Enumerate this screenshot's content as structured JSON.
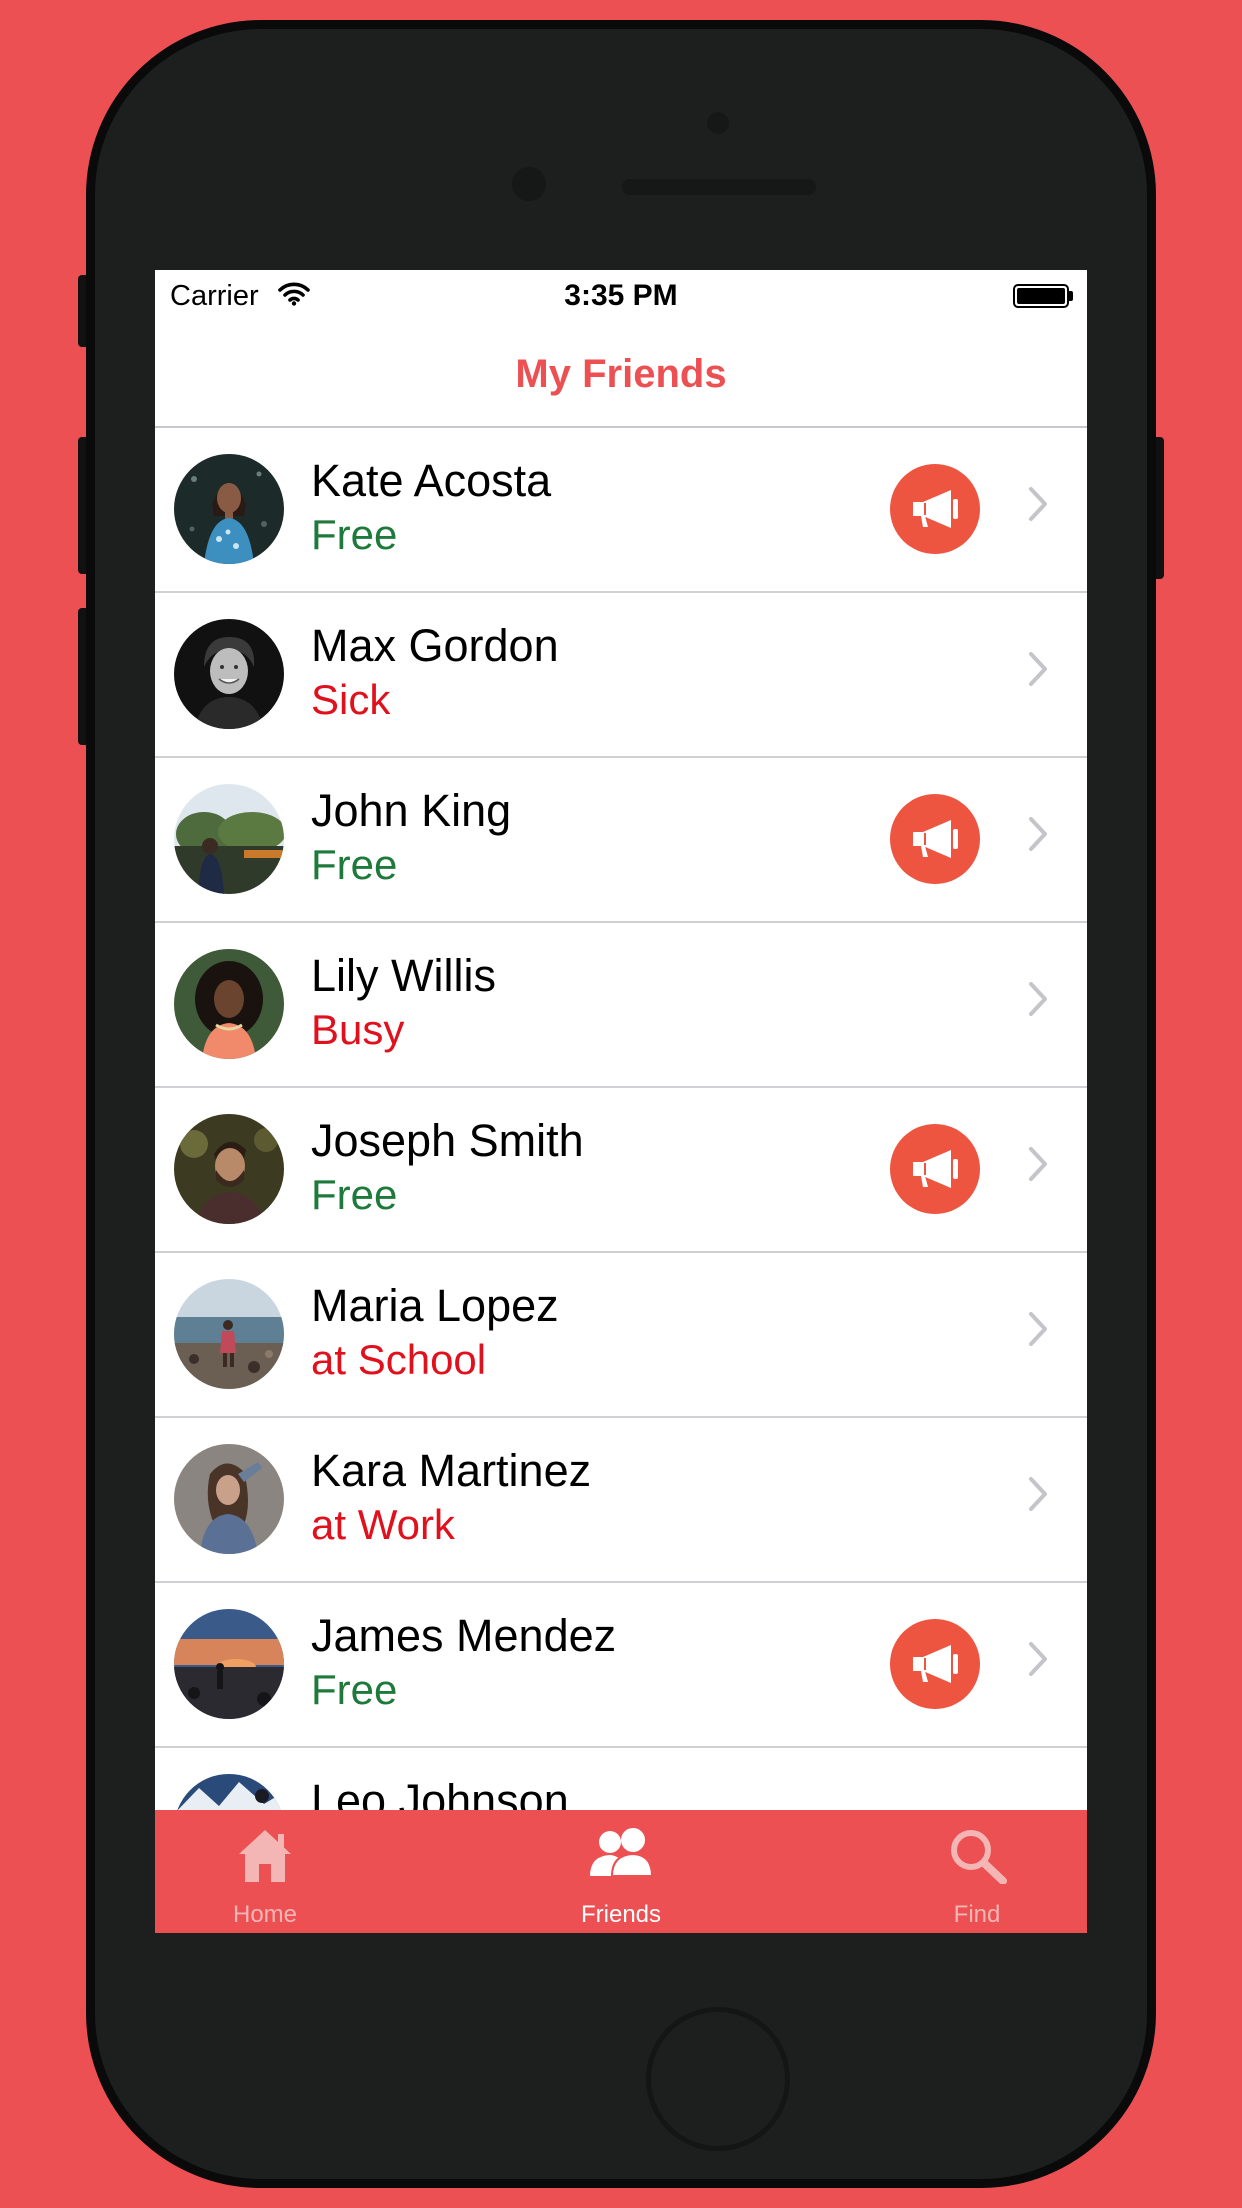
{
  "colors": {
    "background": "#ED5052",
    "accent": "#ED5052",
    "free": "#1E7A3A",
    "unavailable": "#E0101C",
    "notify": "#EE5540",
    "tab_active": "#FFFFFF",
    "tab_inactive": "#F4B5B5"
  },
  "status_bar": {
    "carrier": "Carrier",
    "time": "3:35 PM",
    "icons": [
      "wifi-icon",
      "battery-icon"
    ]
  },
  "nav": {
    "title": "My Friends"
  },
  "friends": [
    {
      "name": "Kate Acosta",
      "status": "Free",
      "available": true,
      "avatar": "woman-blue-dress-photo"
    },
    {
      "name": "Max Gordon",
      "status": "Sick",
      "available": false,
      "avatar": "man-smiling-bw-photo"
    },
    {
      "name": "John King",
      "status": "Free",
      "available": true,
      "avatar": "man-outdoors-trees-photo"
    },
    {
      "name": "Lily Willis",
      "status": "Busy",
      "available": false,
      "avatar": "woman-curly-hair-photo"
    },
    {
      "name": "Joseph Smith",
      "status": "Free",
      "available": true,
      "avatar": "bearded-man-photo"
    },
    {
      "name": "Maria Lopez",
      "status": "at School",
      "available": false,
      "avatar": "woman-rocky-beach-photo"
    },
    {
      "name": "Kara Martinez",
      "status": "at Work",
      "available": false,
      "avatar": "woman-denim-jacket-photo"
    },
    {
      "name": "James Mendez",
      "status": "Free",
      "available": true,
      "avatar": "sunset-beach-photo"
    },
    {
      "name": "Leo Johnson",
      "status": "",
      "available": false,
      "avatar": "mountain-landscape-photo"
    }
  ],
  "tabs": [
    {
      "label": "Home",
      "icon": "home-icon",
      "active": false
    },
    {
      "label": "Friends",
      "icon": "friends-icon",
      "active": true
    },
    {
      "label": "Find",
      "icon": "search-icon",
      "active": false
    }
  ]
}
